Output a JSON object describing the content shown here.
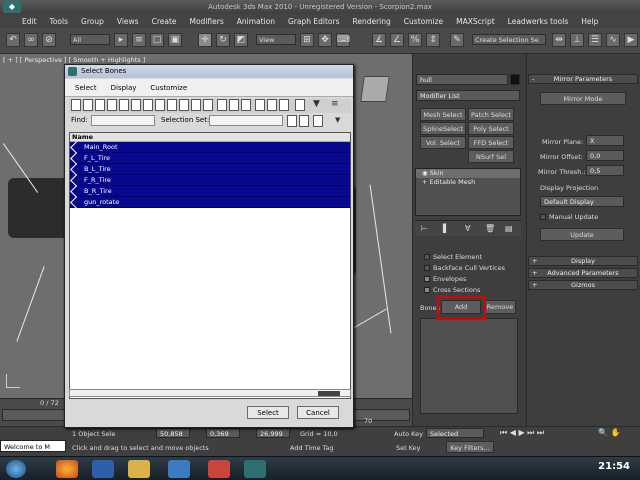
{
  "window": {
    "title": "Autodesk 3ds Max 2010  -  Unregistered Version  -  Scorpion2.max"
  },
  "menu": [
    "Edit",
    "Tools",
    "Group",
    "Views",
    "Create",
    "Modifiers",
    "Animation",
    "Graph Editors",
    "Rendering",
    "Customize",
    "MAXScript",
    "Leadwerks tools",
    "Help"
  ],
  "toolbar": {
    "selection_filter": "All",
    "reference_coord": "View",
    "named_selection": "Create Selection Se"
  },
  "viewport": {
    "label": "[ + ] [ Perspective ] [ Smooth + Highlights ]"
  },
  "command_panel": {
    "object_name": "hull",
    "modifier_list": "Modifier List",
    "buttons": [
      "Mesh Select",
      "Patch Select",
      "SplineSelect",
      "Poly Select",
      "Vol. Select",
      "FFD Select",
      "NSurf Sel"
    ],
    "stack": [
      "Skin",
      "Editable Mesh"
    ],
    "params": {
      "select_element": "Select Element",
      "backface": "Backface Cull Vertices",
      "envelopes": "Envelopes",
      "cross_sections": "Cross Sections",
      "bones_label": "Bones",
      "add": "Add",
      "remove": "Remove"
    }
  },
  "rollout": {
    "mirror_params": "Mirror Parameters",
    "mirror_mode": "Mirror Mode",
    "mirror_plane_label": "Mirror Plane:",
    "mirror_plane_value": "X",
    "mirror_offset_label": "Mirror Offset:",
    "mirror_offset_value": "0,0",
    "mirror_thresh_label": "Mirror Thresh.:",
    "mirror_thresh_value": "0,5",
    "display_projection": "Display Projection",
    "display_value": "Default Display",
    "manual_update": "Manual Update",
    "update": "Update",
    "sections": [
      "Display",
      "Advanced Parameters",
      "Gizmos"
    ]
  },
  "dialog": {
    "title": "Select Bones",
    "menu": [
      "Select",
      "Display",
      "Customize"
    ],
    "find_label": "Find:",
    "selection_set_label": "Selection Set:",
    "column_name": "Name",
    "items": [
      "Main_Root",
      "F_L_Tire",
      "B_L_Tire",
      "F_R_Tire",
      "B_R_Tire",
      "gun_rotate"
    ],
    "select_button": "Select",
    "cancel_button": "Cancel"
  },
  "timeline": {
    "frame": "0 / 72",
    "tick_70": "70"
  },
  "status": {
    "objects": "1 Object Sele",
    "x": "50,858",
    "y": "0,369",
    "z": "26,999",
    "grid": "Grid = 10,0",
    "hint": "Click and drag to select and move objects",
    "add_time_tag": "Add Time Tag",
    "auto_key": "Auto Key",
    "set_key": "Set Key",
    "selected": "Selected",
    "key_filters": "Key Filters...",
    "maxscript": "Welcome to M"
  },
  "taskbar": {
    "clock": "21:54"
  },
  "colors": {
    "selected_row": "#08088f",
    "highlight": "#e00000"
  }
}
